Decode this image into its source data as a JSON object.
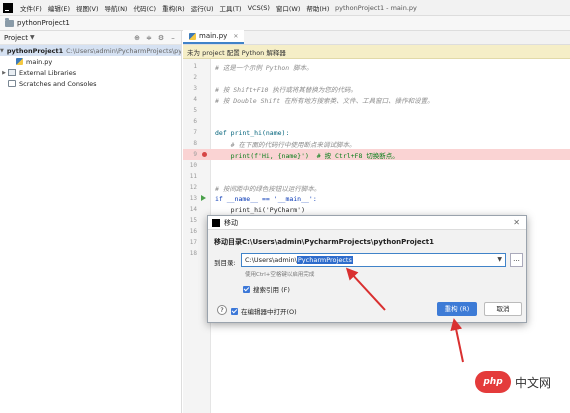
{
  "menubar": {
    "items": [
      "文件(F)",
      "编辑(E)",
      "视图(V)",
      "导航(N)",
      "代码(C)",
      "重构(R)",
      "运行(U)",
      "工具(T)",
      "VCS(S)",
      "窗口(W)",
      "帮助(H)"
    ],
    "window_title": "pythonProject1 - main.py"
  },
  "projbar": {
    "label": "pythonProject1"
  },
  "project_panel": {
    "title": "Project",
    "tree": {
      "root_name": "pythonProject1",
      "root_path": "C:\\Users\\admin\\PycharmProjects\\pythonProject1",
      "file": "main.py",
      "libs": "External Libraries",
      "scratches": "Scratches and Consoles"
    }
  },
  "editor": {
    "tab": "main.py",
    "banner": "未为 project 配置 Python 解释器",
    "lines": [
      {
        "n": "1",
        "text": "# 这是一个示例 Python 脚本。"
      },
      {
        "n": "2",
        "text": ""
      },
      {
        "n": "3",
        "text": "# 按 Shift+F10 执行或将其替换为您的代码。"
      },
      {
        "n": "4",
        "text": "# 按 Double Shift 在所有地方搜索类、文件、工具窗口、操作和设置。"
      },
      {
        "n": "5",
        "text": ""
      },
      {
        "n": "6",
        "text": ""
      },
      {
        "n": "7",
        "text": "def print_hi(name):"
      },
      {
        "n": "8",
        "text": "    # 在下面的代码行中使用断点来调试脚本。"
      },
      {
        "n": "9",
        "text": "    print(f'Hi, {name}')  # 按 Ctrl+F8 切换断点。"
      },
      {
        "n": "10",
        "text": ""
      },
      {
        "n": "11",
        "text": ""
      },
      {
        "n": "12",
        "text": "# 按间距中的绿色按钮以运行脚本。"
      },
      {
        "n": "13",
        "text": "if __name__ == '__main__':"
      },
      {
        "n": "14",
        "text": "    print_hi('PyCharm')"
      },
      {
        "n": "15",
        "text": ""
      },
      {
        "n": "16",
        "text": ""
      },
      {
        "n": "17",
        "text": ""
      },
      {
        "n": "18",
        "text": ""
      }
    ]
  },
  "dialog": {
    "title": "移动",
    "heading": "移动目录C:\\Users\\admin\\PycharmProjects\\pythonProject1",
    "to_dir_label": "到目录:",
    "path_prefix": "C:\\Users\\admin\\",
    "path_selected": "PycharmProjects",
    "browse": "...",
    "hint": "使用Ctrl+空格键以启用完成",
    "search_refs": "搜索引用 (F)",
    "help": "?",
    "open_in_editor": "在编辑器中打开(O)",
    "ok": "重构 (R)",
    "cancel": "取消"
  },
  "watermark": {
    "logo": "php",
    "text": "中文网"
  },
  "colors": {
    "accent": "#3d7bd6",
    "breakpoint_line": "#fad3d3",
    "arrow": "#d93030"
  }
}
